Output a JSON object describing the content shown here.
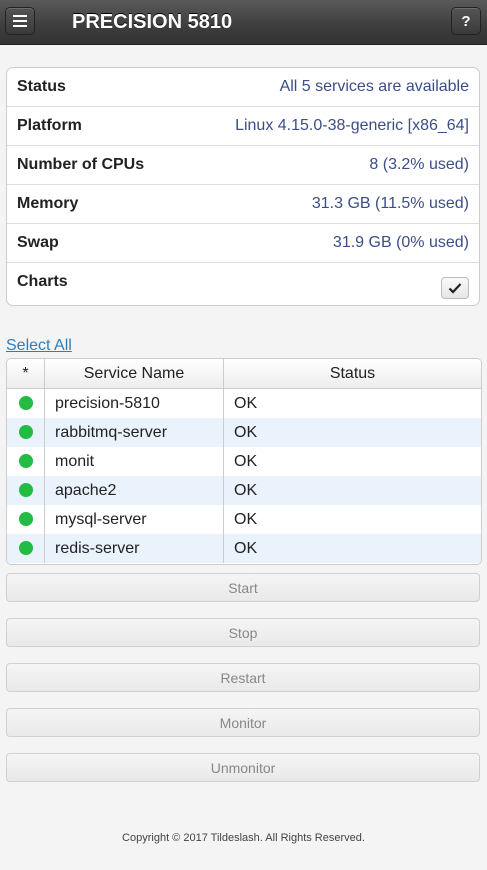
{
  "header": {
    "title": "PRECISION 5810",
    "help_label": "?"
  },
  "info": [
    {
      "label": "Status",
      "value": "All 5 services are available"
    },
    {
      "label": "Platform",
      "value": "Linux 4.15.0-38-generic [x86_64]"
    },
    {
      "label": "Number of CPUs",
      "value": "8 (3.2% used)"
    },
    {
      "label": "Memory",
      "value": "31.3 GB (11.5% used)"
    },
    {
      "label": "Swap",
      "value": "31.9 GB (0% used)"
    },
    {
      "label": "Charts",
      "checked": true
    }
  ],
  "select_all_label": "Select All",
  "table": {
    "columns": [
      "*",
      "Service Name",
      "Status"
    ],
    "rows": [
      {
        "name": "precision-5810",
        "status": "OK"
      },
      {
        "name": "rabbitmq-server",
        "status": "OK"
      },
      {
        "name": "monit",
        "status": "OK"
      },
      {
        "name": "apache2",
        "status": "OK"
      },
      {
        "name": "mysql-server",
        "status": "OK"
      },
      {
        "name": "redis-server",
        "status": "OK"
      }
    ],
    "status_color": "#22bb44"
  },
  "actions": [
    "Start",
    "Stop",
    "Restart",
    "Monitor",
    "Unmonitor"
  ],
  "footer": "Copyright © 2017 Tildeslash. All Rights Reserved."
}
